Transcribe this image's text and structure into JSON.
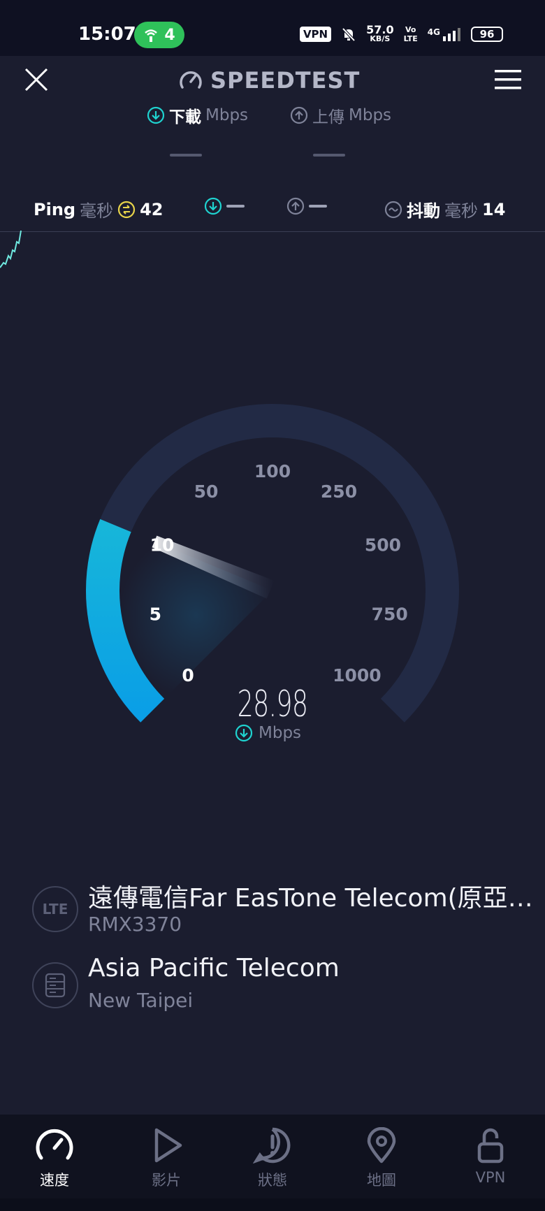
{
  "status_bar": {
    "time": "15:07",
    "hotspot_count": "4",
    "vpn": "VPN",
    "net_speed_value": "57.0",
    "net_speed_unit": "KB/S",
    "volte_top": "Vo",
    "volte_bottom": "LTE",
    "network": "4G",
    "battery": "96"
  },
  "header": {
    "title": "SPEEDTEST",
    "close_icon": "close-icon",
    "menu_icon": "menu-icon"
  },
  "tabs": {
    "download_label": "下載",
    "download_unit": "Mbps",
    "upload_label": "上傳",
    "upload_unit": "Mbps"
  },
  "metrics": {
    "ping_label": "Ping",
    "ping_unit": "毫秒",
    "ping_value": "42",
    "jitter_label": "抖動",
    "jitter_unit": "毫秒",
    "jitter_value": "14"
  },
  "gauge": {
    "ticks": [
      "0",
      "5",
      "10",
      "50",
      "100",
      "250",
      "500",
      "750",
      "1000"
    ],
    "speed_value": "28.98",
    "speed_unit": "Mbps",
    "level": 0.25
  },
  "provider": {
    "badge": "LTE",
    "name": "遠傳電信Far EasTone Telecom(原亞太電信)",
    "device": "RMX3370"
  },
  "server": {
    "name": "Asia Pacific Telecom",
    "location": "New Taipei"
  },
  "bottom_nav": [
    {
      "label": "速度",
      "icon": "speedometer-icon",
      "active": true
    },
    {
      "label": "影片",
      "icon": "play-icon",
      "active": false
    },
    {
      "label": "狀態",
      "icon": "alert-icon",
      "active": false
    },
    {
      "label": "地圖",
      "icon": "map-pin-icon",
      "active": false
    },
    {
      "label": "VPN",
      "icon": "unlock-icon",
      "active": false
    }
  ],
  "colors": {
    "background": "#1b1d2f",
    "accent_cyan": "#1fd3d0",
    "arc_blue": "#0aa4e6",
    "ping_yellow": "#e8d44a"
  }
}
